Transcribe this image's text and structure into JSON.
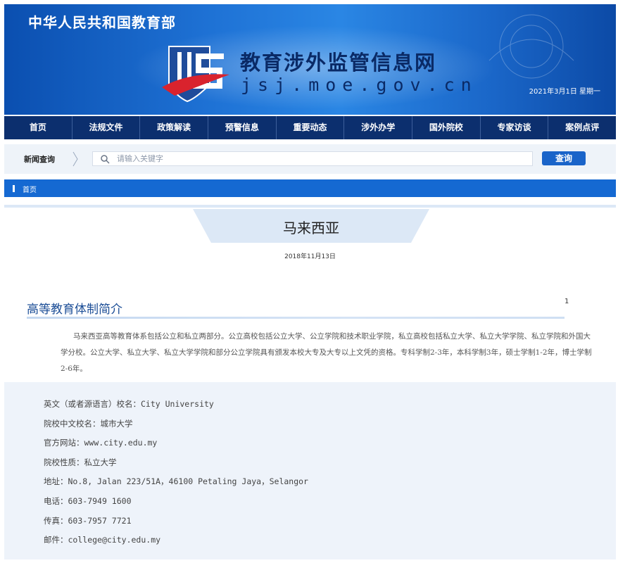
{
  "header": {
    "ministry": "中华人民共和国教育部",
    "site_title": "教育涉外监管信息网",
    "site_domain": "jsj.moe.gov.cn",
    "date": "2021年3月1日  星期一"
  },
  "nav": {
    "items": [
      "首页",
      "法规文件",
      "政策解读",
      "预警信息",
      "重要动态",
      "涉外办学",
      "国外院校",
      "专家访谈",
      "案例点评"
    ]
  },
  "search": {
    "label": "新闻查询",
    "placeholder": "请输入关键字",
    "button": "查询"
  },
  "breadcrumb": {
    "home": "首页"
  },
  "article": {
    "title": "马来西亚",
    "date": "2018年11月13日",
    "section_title": "高等教育体制简介",
    "page_number": "1",
    "paragraph": "马来西亚高等教育体系包括公立和私立两部分。公立高校包括公立大学、公立学院和技术职业学院，私立高校包括私立大学、私立大学学院、私立学院和外国大学分校。公立大学、私立大学、私立大学学院和部分公立学院具有颁发本校大专及大专以上文凭的资格。专科学制2-3年，本科学制3年，硕士学制1-2年，博士学制2-6年。"
  },
  "school_info": [
    "英文（或者源语言）校名：City University",
    "院校中文校名：城市大学",
    "官方网站：www.city.edu.my",
    "院校性质：私立大学",
    "地址：No.8, Jalan 223/51A，46100 Petaling Jaya，Selangor",
    "电话：603-7949 1600",
    "传真：603-7957 7721",
    "邮件：college@city.edu.my"
  ],
  "colors": {
    "nav_bg": "#0c2f6e",
    "accent_blue": "#1569d2",
    "button_blue": "#1a64c9",
    "info_bg": "#eef3fa"
  }
}
